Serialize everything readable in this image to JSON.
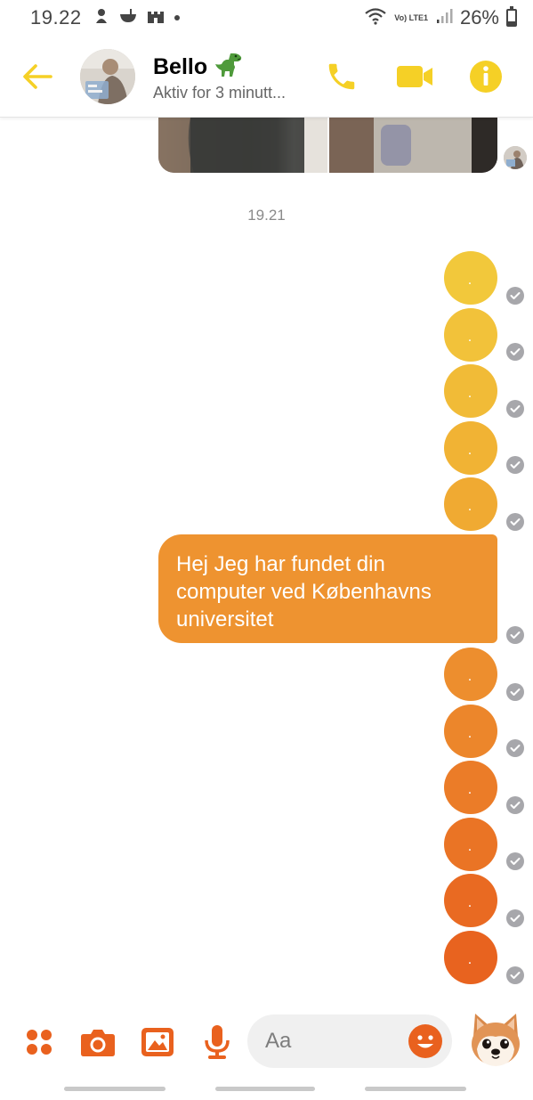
{
  "colors": {
    "accent_yellow": "#f5d026",
    "accent_orange": "#e9611e",
    "check_gray": "#a7a7ab"
  },
  "status_bar": {
    "time": "19.22",
    "battery": "26%",
    "network_label": "Vo) LTE1",
    "icons": [
      "notification-icon",
      "bowl-icon",
      "castle-icon",
      "dot-icon",
      "wifi-icon",
      "signal-icon",
      "battery-icon"
    ]
  },
  "header": {
    "contact_name": "Bello",
    "contact_emoji": "dinosaur-emoji",
    "status_text": "Aktiv for 3 minutt...",
    "icons": [
      "back-arrow-icon",
      "phone-icon",
      "video-camera-icon",
      "info-icon"
    ]
  },
  "conversation": {
    "timestamp": "19.21",
    "messages_before": [
      ".",
      ".",
      ".",
      ".",
      "."
    ],
    "text_message": [
      "Hej Jeg har fundet din",
      "computer ved Københavns",
      "universitet"
    ],
    "messages_after": [
      ".",
      ".",
      ".",
      ".",
      ".",
      "."
    ],
    "bubble_colors_before": [
      "#f2c83b",
      "#f2c23a",
      "#f1bb37",
      "#f1b334",
      "#f0aa32"
    ],
    "bubble_colors_after": [
      "#ed8e2e",
      "#ec862b",
      "#eb7c28",
      "#ea7425",
      "#e96a22",
      "#e8631f"
    ]
  },
  "composer": {
    "placeholder": "Aa",
    "icons": [
      "apps-icon",
      "camera-icon",
      "gallery-icon",
      "microphone-icon",
      "emoji-icon",
      "sticker-dog-icon"
    ]
  }
}
